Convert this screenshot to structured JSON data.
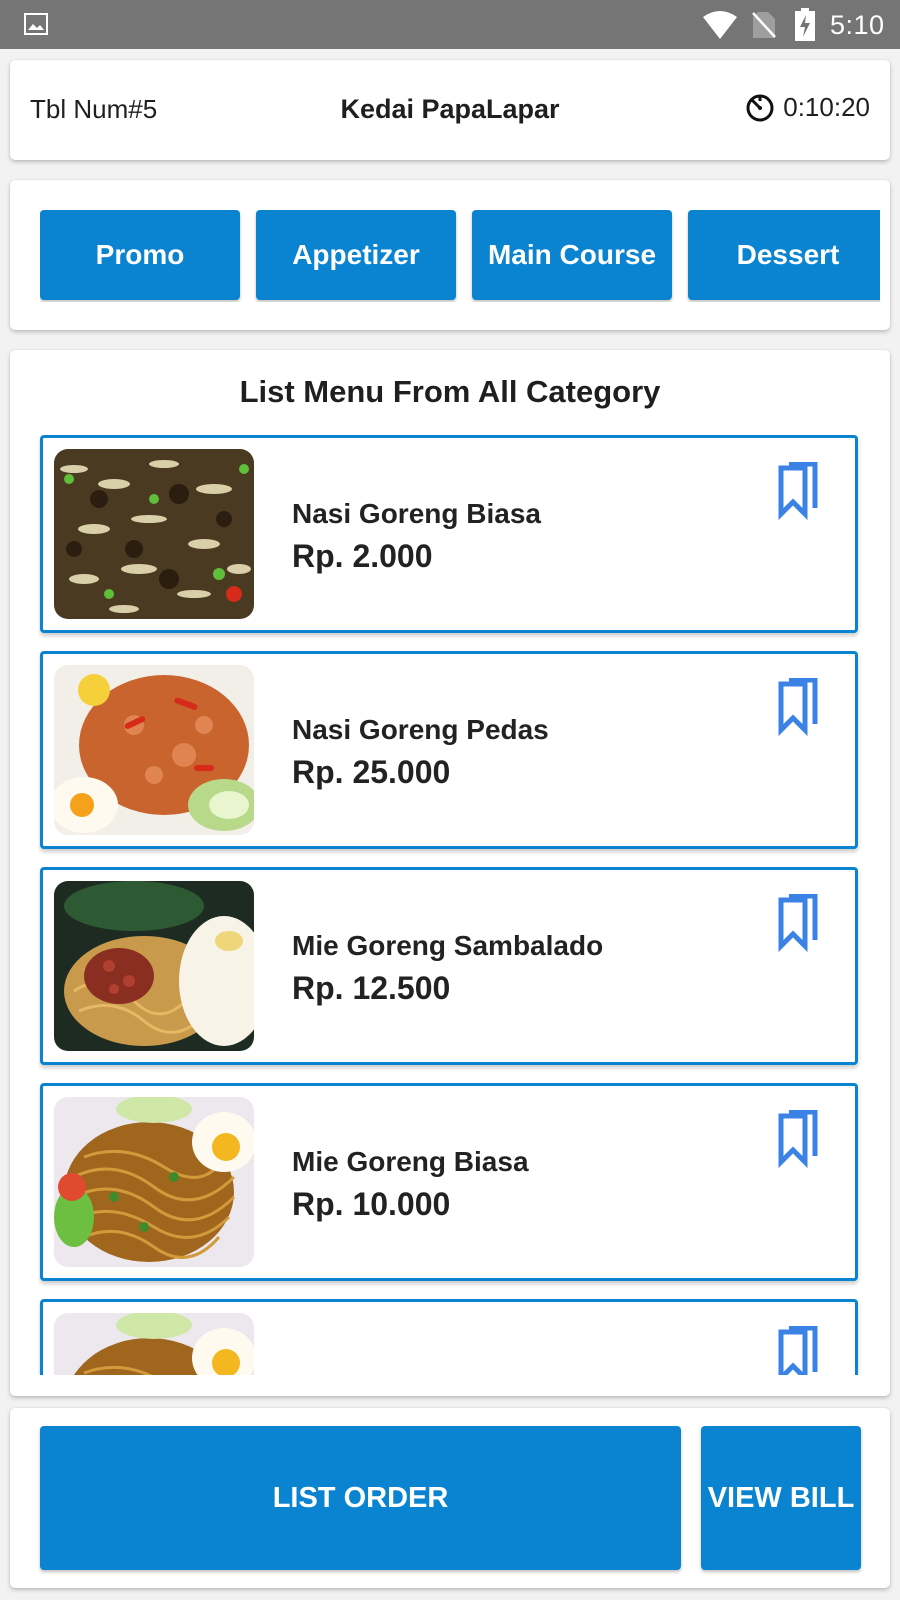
{
  "status_bar": {
    "time": "5:10",
    "icons": [
      "gallery-icon",
      "wifi-icon",
      "no-sim-icon",
      "battery-charging-icon"
    ]
  },
  "header": {
    "table_number": "Tbl Num#5",
    "restaurant_name": "Kedai PapaLapar",
    "timer": "0:10:20",
    "timer_icon": "timer-icon"
  },
  "categories": [
    {
      "label": "Promo"
    },
    {
      "label": "Appetizer"
    },
    {
      "label": "Main Course"
    },
    {
      "label": "Dessert"
    }
  ],
  "menu": {
    "title": "List Menu From All Category",
    "items": [
      {
        "name": "Nasi Goreng Biasa",
        "price": "Rp. 2.000",
        "image": "fried-rice-beef-photo"
      },
      {
        "name": "Nasi Goreng Pedas",
        "price": "Rp. 25.000",
        "image": "spicy-fried-rice-photo"
      },
      {
        "name": "Mie Goreng Sambalado",
        "price": "Rp. 12.500",
        "image": "fried-noodle-sambal-photo"
      },
      {
        "name": "Mie Goreng Biasa",
        "price": "Rp. 10.000",
        "image": "fried-noodle-photo"
      },
      {
        "name": "",
        "price": "",
        "image": "fried-noodle-photo"
      }
    ]
  },
  "actions": {
    "list_order": "LIST ORDER",
    "view_bill": "VIEW BILL"
  },
  "colors": {
    "primary": "#0a84d1",
    "bookmark": "#3b82e6",
    "status_bar": "#757575"
  }
}
